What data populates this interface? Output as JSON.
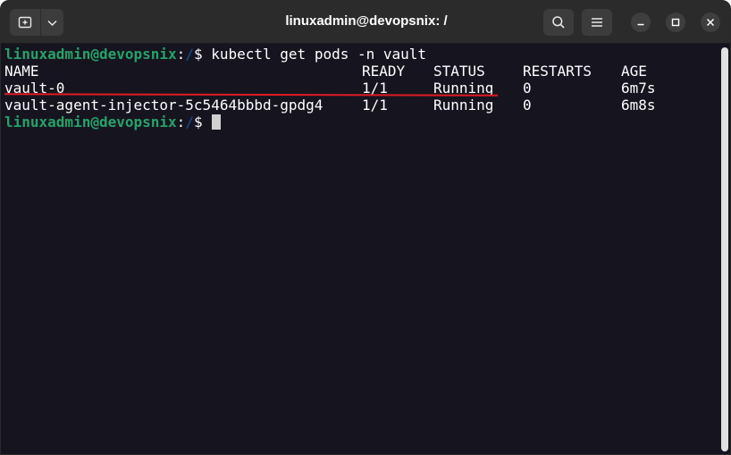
{
  "window": {
    "title": "linuxadmin@devopsnix: /",
    "icons": {
      "new_tab": "new-tab-icon",
      "tab_dropdown": "chevron-down-icon",
      "search": "search-icon",
      "menu": "hamburger-menu-icon",
      "minimize": "minimize-icon",
      "maximize": "maximize-icon",
      "close": "close-icon"
    }
  },
  "terminal": {
    "prompt_user": "linuxadmin@devopsnix",
    "prompt_sep": ":",
    "prompt_path": "/",
    "prompt_symbol": "$",
    "command": "kubectl get pods -n vault",
    "headers": {
      "name": "NAME",
      "ready": "READY",
      "status": "STATUS",
      "restarts": "RESTARTS",
      "age": "AGE"
    },
    "rows": [
      {
        "name": "vault-0",
        "ready": "1/1",
        "status": "Running",
        "restarts": "0",
        "age": "6m7s"
      },
      {
        "name": "vault-agent-injector-5c5464bbbd-gpdg4",
        "ready": "1/1",
        "status": "Running",
        "restarts": "0",
        "age": "6m8s"
      }
    ]
  },
  "colors": {
    "prompt_user": "#26a269",
    "prompt_path": "#12488b",
    "highlight_underline": "#e01b24",
    "terminal_bg": "#16151f"
  }
}
